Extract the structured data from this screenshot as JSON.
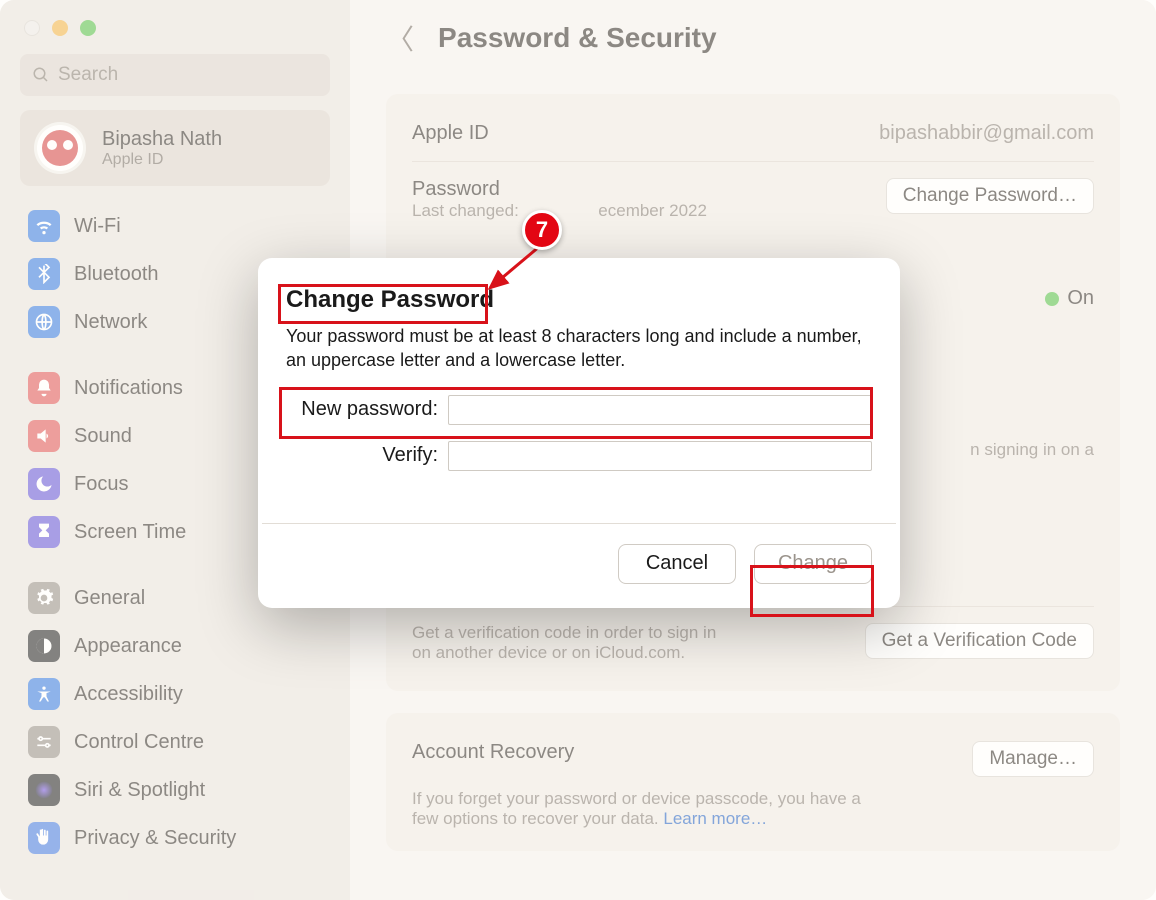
{
  "annotation": {
    "badge": "7"
  },
  "window": {
    "search_placeholder": "Search",
    "user": {
      "name": "Bipasha Nath",
      "subtitle": "Apple ID"
    },
    "sidebar_groups": [
      [
        {
          "icon": "wifi",
          "label": "Wi-Fi"
        },
        {
          "icon": "bluetooth",
          "label": "Bluetooth"
        },
        {
          "icon": "network",
          "label": "Network"
        }
      ],
      [
        {
          "icon": "bell",
          "label": "Notifications"
        },
        {
          "icon": "sound",
          "label": "Sound"
        },
        {
          "icon": "moon",
          "label": "Focus"
        },
        {
          "icon": "hourglass",
          "label": "Screen Time"
        }
      ],
      [
        {
          "icon": "gear",
          "label": "General"
        },
        {
          "icon": "appearance",
          "label": "Appearance"
        },
        {
          "icon": "accessibility",
          "label": "Accessibility"
        },
        {
          "icon": "control",
          "label": "Control Centre"
        },
        {
          "icon": "siri",
          "label": "Siri & Spotlight"
        },
        {
          "icon": "hand",
          "label": "Privacy & Security"
        }
      ]
    ]
  },
  "header": {
    "title": "Password & Security"
  },
  "panel_main": {
    "apple_id_label": "Apple ID",
    "apple_id_value": "bipashabbir@gmail.com",
    "password_label": "Password",
    "password_sub_prefix": "Last changed:",
    "password_sub_suffix": "ecember 2022",
    "change_password_btn": "Change Password…",
    "on_label": "On",
    "signin_hint_fragment": "n signing in on a",
    "verification_text_l1": "Get a verification code in order to sign in",
    "verification_text_l2": "on another device or on iCloud.com.",
    "verification_btn": "Get a Verification Code"
  },
  "panel_recovery": {
    "title": "Account Recovery",
    "manage_btn": "Manage…",
    "desc_l1": "If you forget your password or device passcode, you have a",
    "desc_l2_prefix": "few options to recover your data. ",
    "learn_more": "Learn more…"
  },
  "modal": {
    "title": "Change Password",
    "hint": "Your password must be at least 8 characters long and include a number, an uppercase letter and a lowercase letter.",
    "new_password_label": "New password:",
    "verify_label": "Verify:",
    "cancel": "Cancel",
    "change": "Change"
  }
}
